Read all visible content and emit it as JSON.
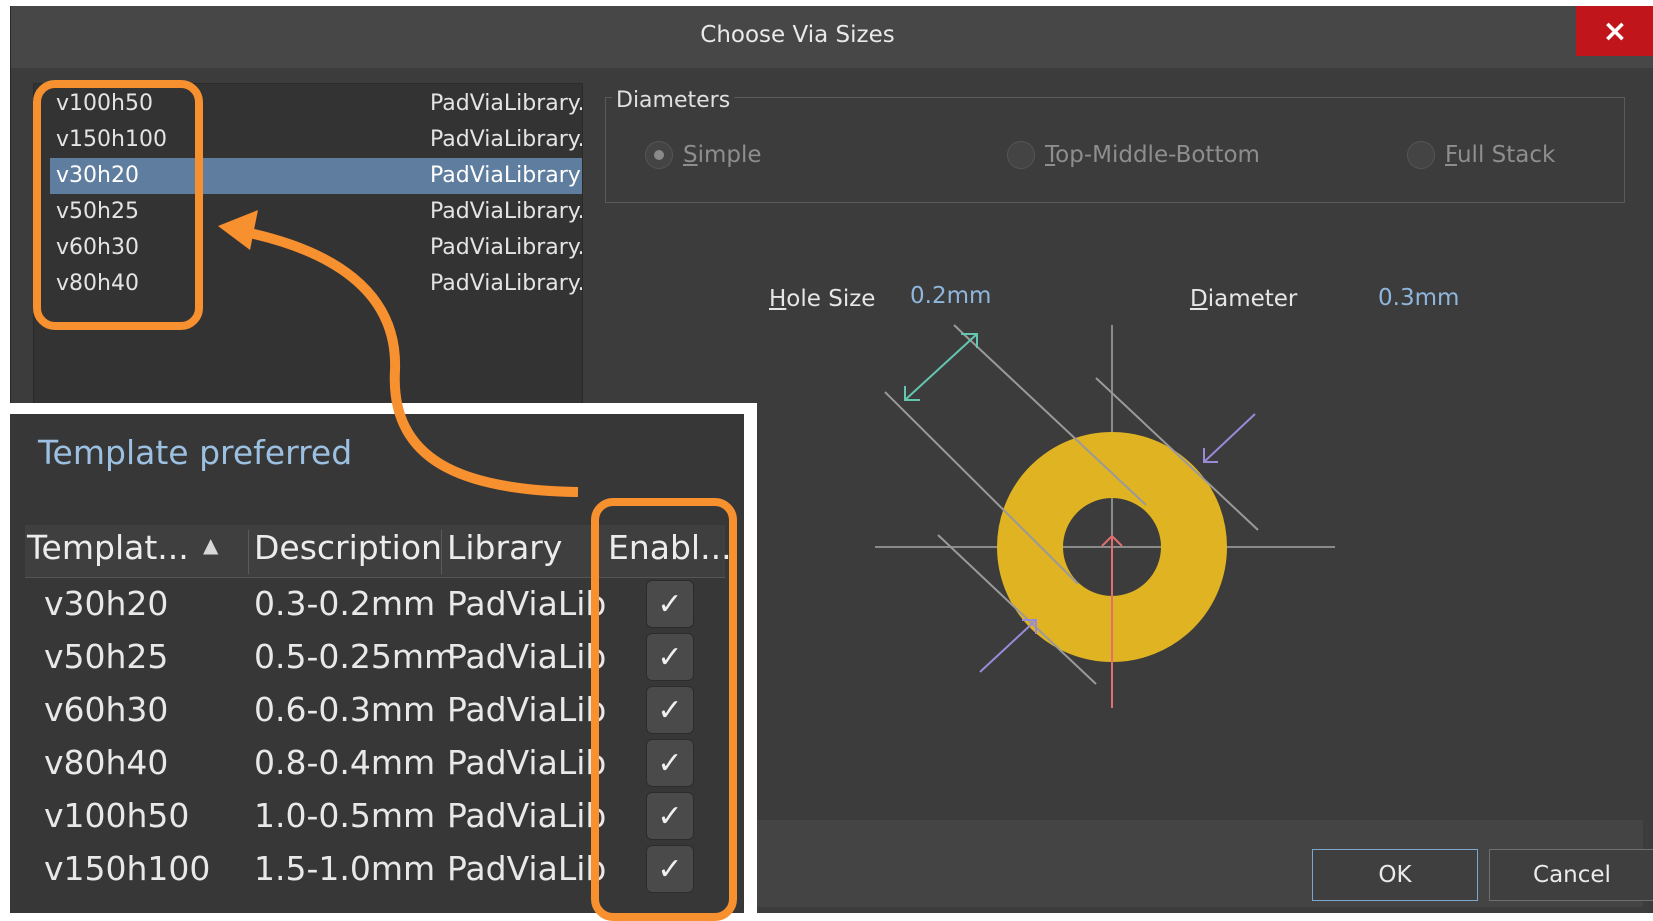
{
  "dialog": {
    "title": "Choose Via Sizes",
    "close_icon": "×",
    "ok_label": "OK",
    "cancel_label": "Cancel"
  },
  "via_list": [
    {
      "name": "v100h50",
      "library": "PadViaLibrary.",
      "selected": false
    },
    {
      "name": "v150h100",
      "library": "PadViaLibrary.",
      "selected": false
    },
    {
      "name": "v30h20",
      "library": "PadViaLibrary",
      "selected": true
    },
    {
      "name": "v50h25",
      "library": "PadViaLibrary.",
      "selected": false
    },
    {
      "name": "v60h30",
      "library": "PadViaLibrary.",
      "selected": false
    },
    {
      "name": "v80h40",
      "library": "PadViaLibrary.",
      "selected": false
    }
  ],
  "diameters": {
    "legend": "Diameters",
    "options": [
      {
        "label_first": "S",
        "label_rest": "imple",
        "checked": true
      },
      {
        "label_first": "T",
        "label_rest": "op-Middle-Bottom",
        "checked": false
      },
      {
        "label_first": "F",
        "label_rest": "ull Stack",
        "checked": false
      }
    ]
  },
  "sizes": {
    "hole_label_first": "H",
    "hole_label_rest": "ole Size",
    "hole_value": "0.2mm",
    "diameter_label_first": "D",
    "diameter_label_rest": "iameter",
    "diameter_value": "0.3mm"
  },
  "template_panel": {
    "title": "Template preferred",
    "columns": [
      "Templat...",
      "Description",
      "Library",
      "Enabl..."
    ],
    "sort_icon": "▲",
    "rows": [
      {
        "template": "v30h20",
        "description": "0.3-0.2mm",
        "library": "PadViaLib",
        "enabled": "✓"
      },
      {
        "template": "v50h25",
        "description": "0.5-0.25mm",
        "library": "PadViaLib",
        "enabled": "✓"
      },
      {
        "template": "v60h30",
        "description": "0.6-0.3mm",
        "library": "PadViaLib",
        "enabled": "✓"
      },
      {
        "template": "v80h40",
        "description": "0.8-0.4mm",
        "library": "PadViaLib",
        "enabled": "✓"
      },
      {
        "template": "v100h50",
        "description": "1.0-0.5mm",
        "library": "PadViaLib",
        "enabled": "✓"
      },
      {
        "template": "v150h100",
        "description": "1.5-1.0mm",
        "library": "PadViaLib",
        "enabled": "✓"
      }
    ]
  },
  "colors": {
    "highlight": "#f7902f",
    "via_copper": "#e0b323",
    "selection": "#5f7d9e",
    "close": "#c0151a"
  }
}
